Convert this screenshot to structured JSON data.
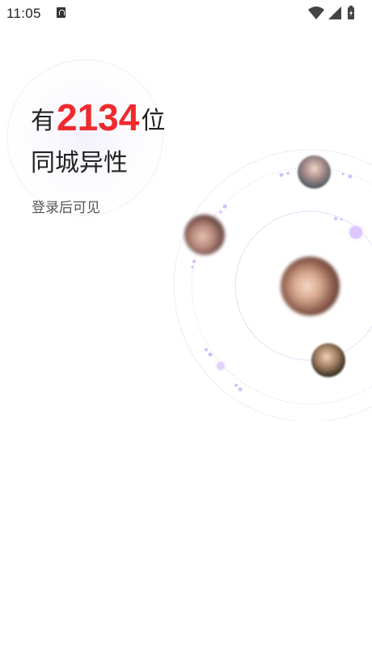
{
  "status_bar": {
    "time": "11:05"
  },
  "headline": {
    "prefix": "有",
    "count": "2134",
    "suffix": "位",
    "subtitle": "同城异性"
  },
  "hint": "登录后可见",
  "icons": [
    "notification-a-icon",
    "wifi-icon",
    "signal-icon",
    "battery-charging-icon"
  ],
  "colors": {
    "accent": "#ee2a2f",
    "orbit": "#d9d4f0",
    "dot": "#d9b8ff"
  }
}
